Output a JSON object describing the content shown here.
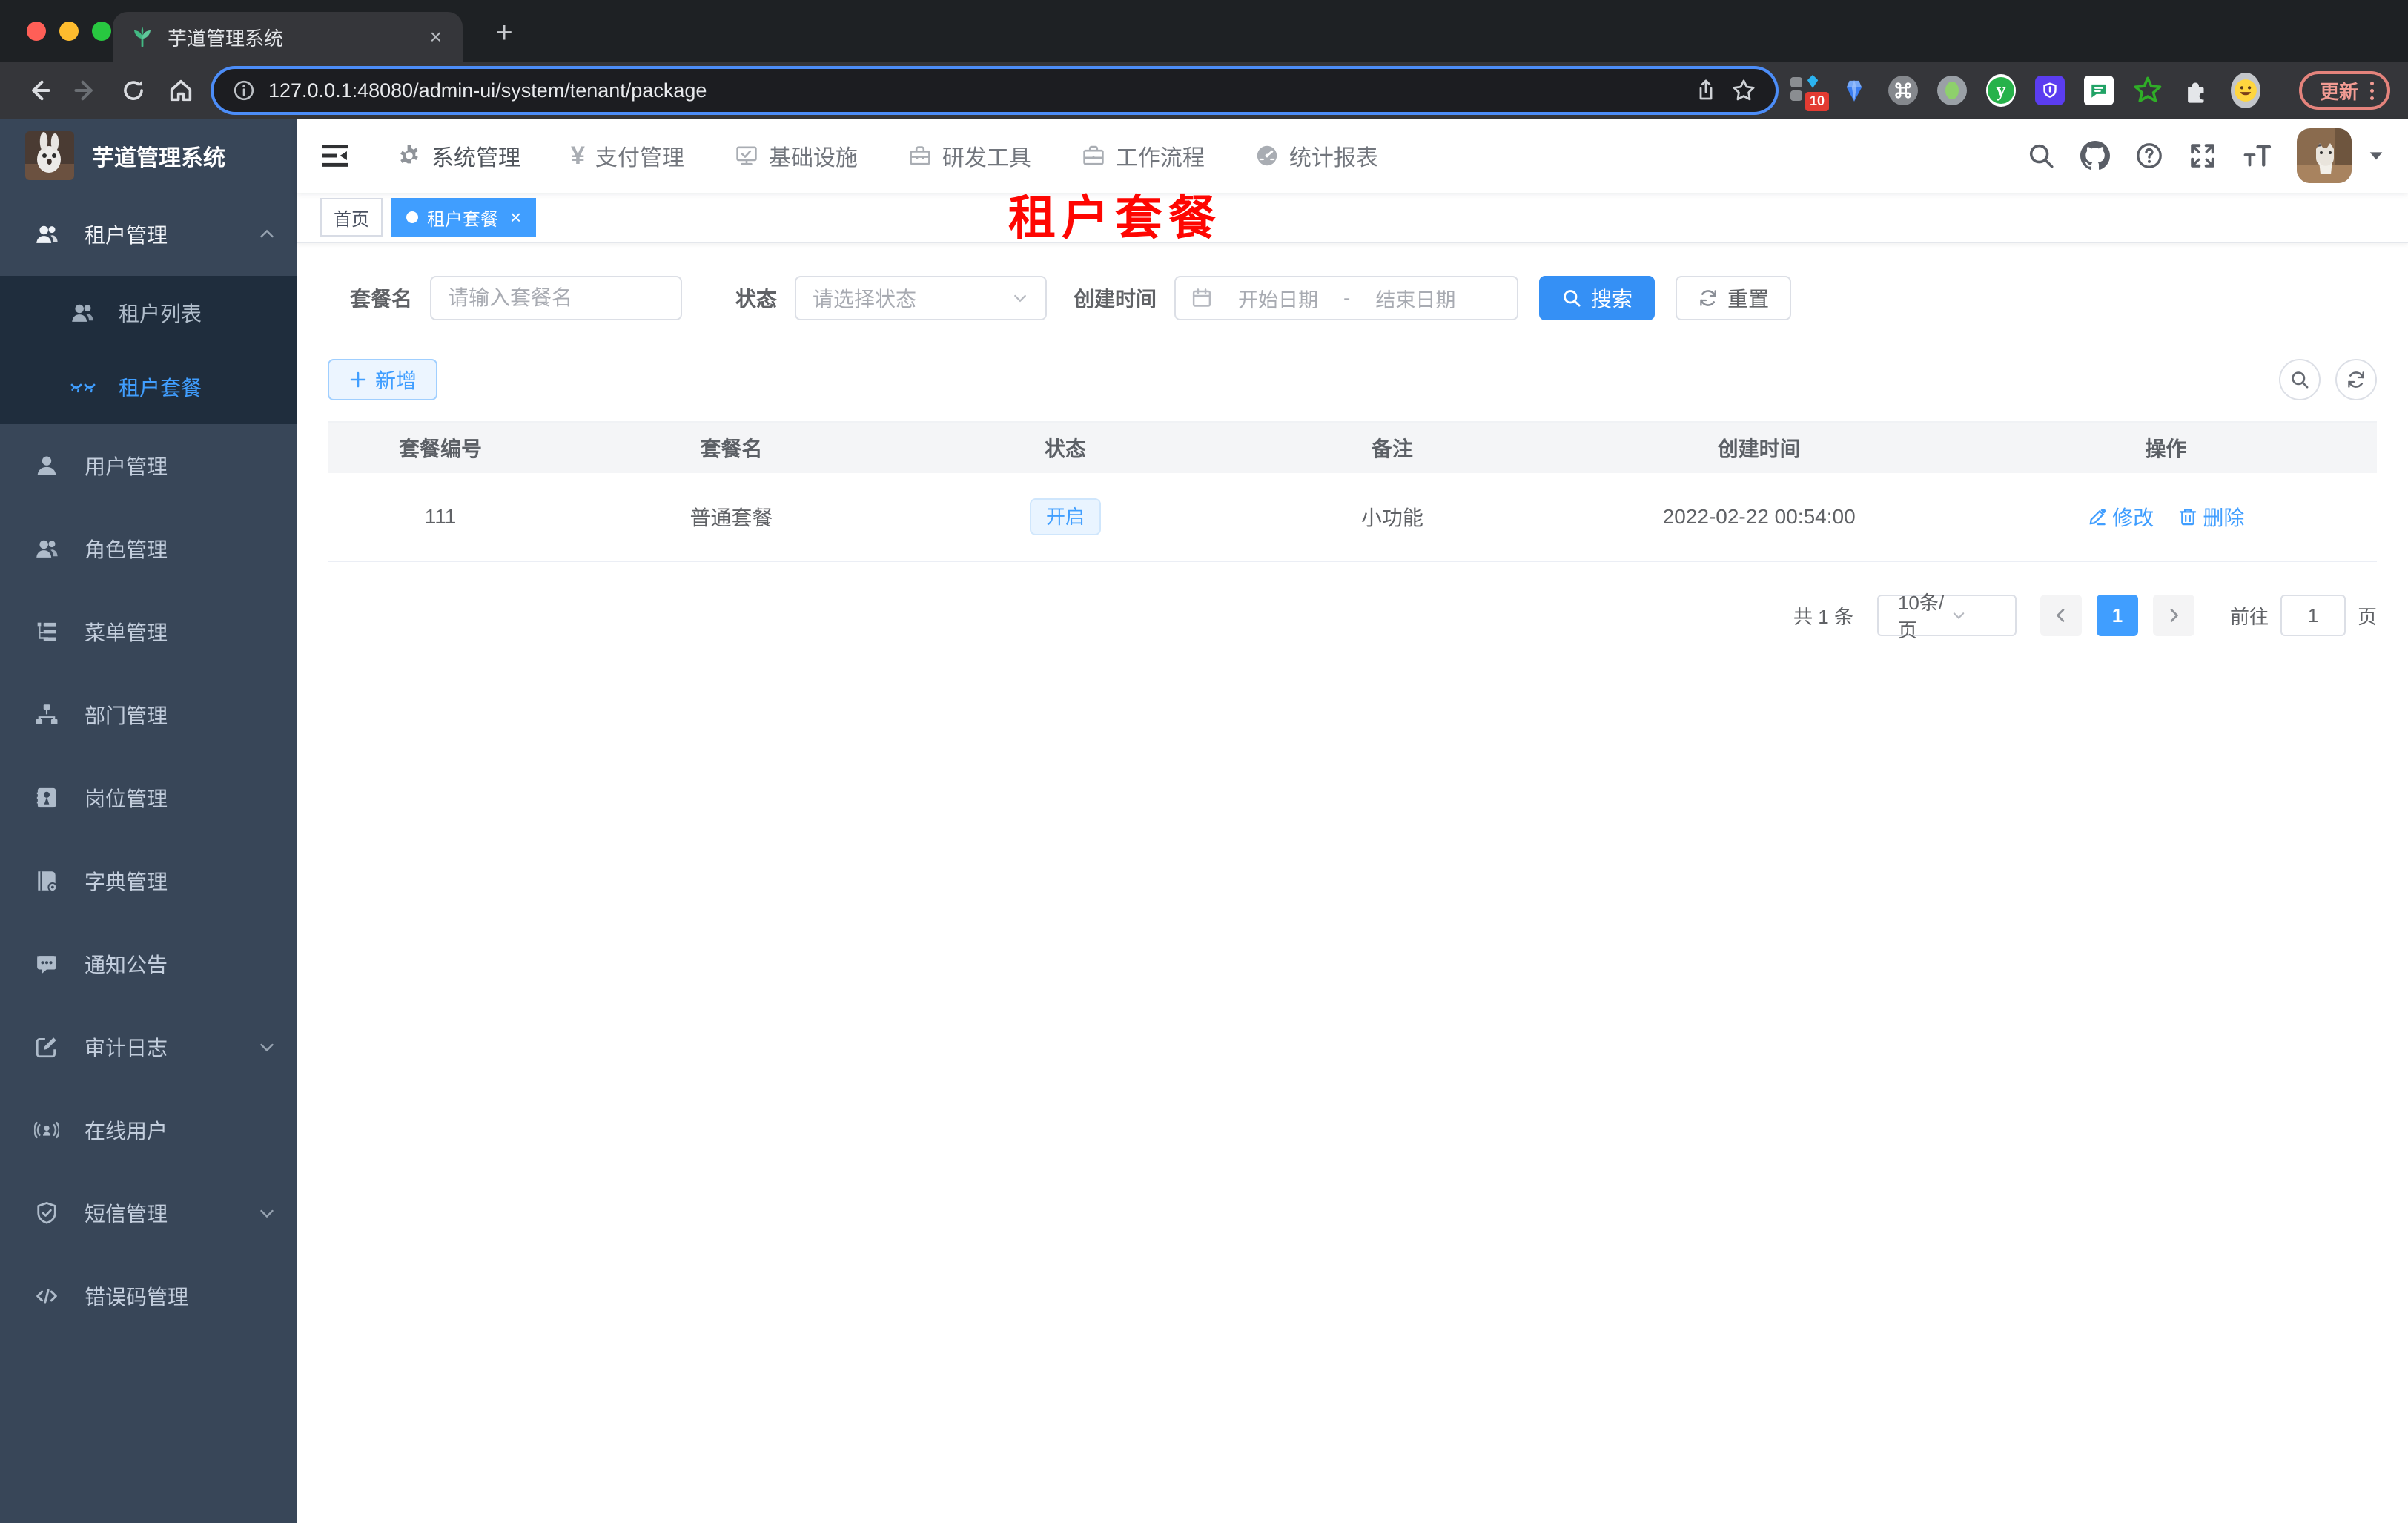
{
  "browser": {
    "tab": {
      "title": "芋道管理系统",
      "close": "×",
      "new_tab": "+"
    },
    "url": "127.0.0.1:48080/admin-ui/system/tenant/package",
    "extensions": {
      "badge": "10",
      "update_label": "更新"
    }
  },
  "header": {
    "nav": [
      {
        "label": "系统管理"
      },
      {
        "label": "支付管理"
      },
      {
        "label": "基础设施"
      },
      {
        "label": "研发工具"
      },
      {
        "label": "工作流程"
      },
      {
        "label": "统计报表"
      }
    ],
    "yen_glyph": "¥"
  },
  "sidebar": {
    "title": "芋道管理系统",
    "items": [
      {
        "label": "租户管理"
      },
      {
        "label": "租户列表"
      },
      {
        "label": "租户套餐"
      },
      {
        "label": "用户管理"
      },
      {
        "label": "角色管理"
      },
      {
        "label": "菜单管理"
      },
      {
        "label": "部门管理"
      },
      {
        "label": "岗位管理"
      },
      {
        "label": "字典管理"
      },
      {
        "label": "通知公告"
      },
      {
        "label": "审计日志"
      },
      {
        "label": "在线用户"
      },
      {
        "label": "短信管理"
      },
      {
        "label": "错误码管理"
      }
    ]
  },
  "tags": {
    "home": "首页",
    "active": "租户套餐",
    "close": "×"
  },
  "annotation": "租户套餐",
  "filters": {
    "name_label": "套餐名",
    "name_placeholder": "请输入套餐名",
    "status_label": "状态",
    "status_placeholder": "请选择状态",
    "date_label": "创建时间",
    "date_start": "开始日期",
    "date_sep": "-",
    "date_end": "结束日期",
    "search_label": "搜索",
    "reset_label": "重置"
  },
  "toolbar": {
    "add_label": "新增"
  },
  "table": {
    "headers": [
      "套餐编号",
      "套餐名",
      "状态",
      "备注",
      "创建时间",
      "操作"
    ],
    "rows": [
      {
        "id": "111",
        "name": "普通套餐",
        "status": "开启",
        "remark": "小功能",
        "created": "2022-02-22 00:54:00",
        "edit": "修改",
        "delete": "删除"
      }
    ]
  },
  "pagination": {
    "total": "共 1 条",
    "page_size": "10条/页",
    "page": "1",
    "goto_label": "前往",
    "goto_value": "1",
    "unit_label": "页"
  },
  "colors": {
    "primary": "#409eff",
    "sidebar_bg": "#384658",
    "submenu_bg": "#1f2d3d",
    "annotation": "#fe0602"
  }
}
